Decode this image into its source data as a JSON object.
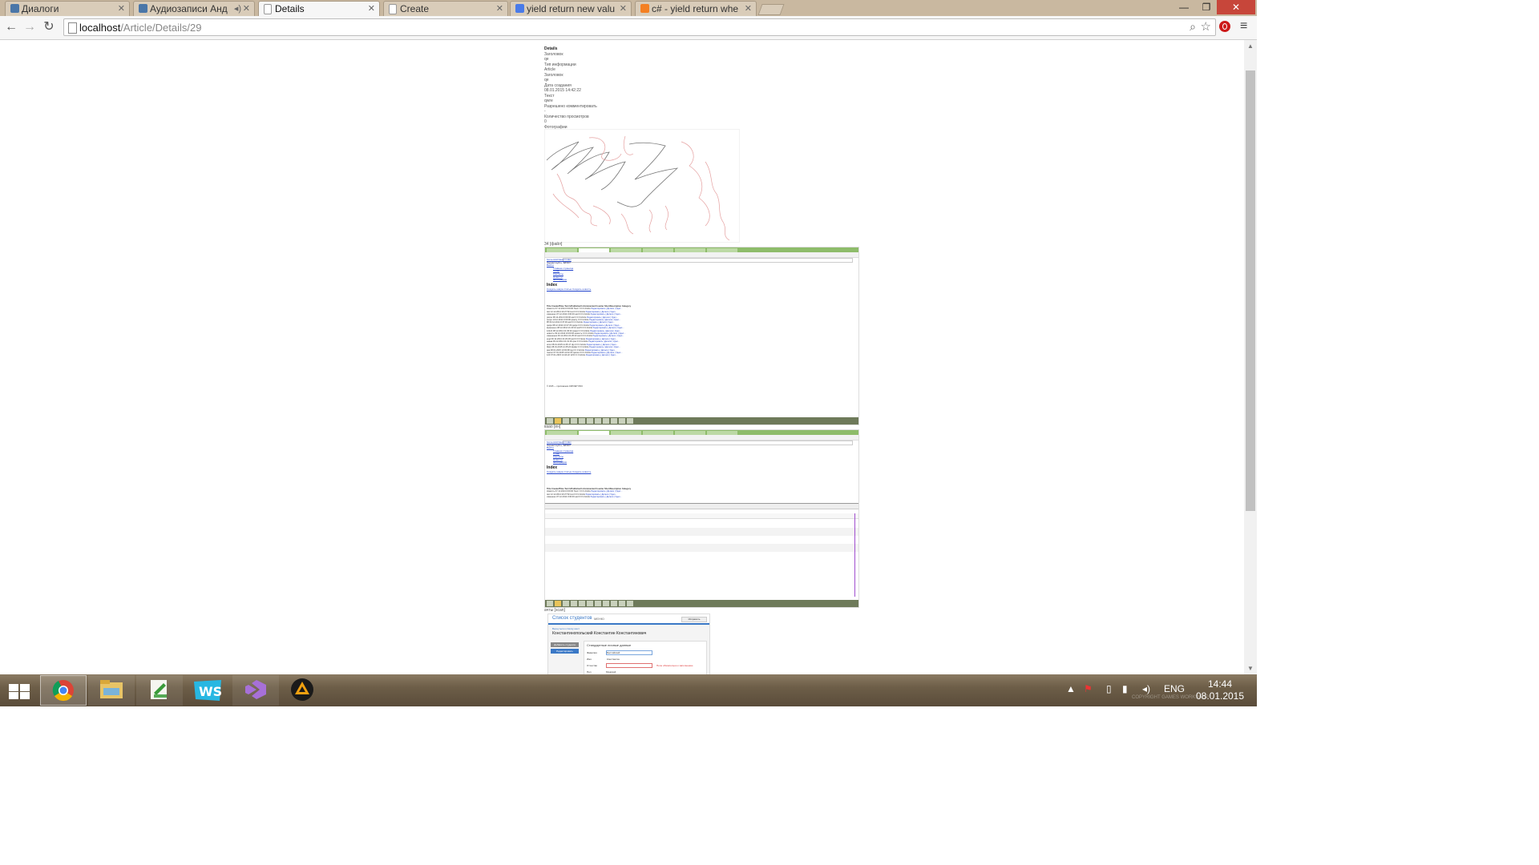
{
  "browser": {
    "tabs": [
      {
        "title": "Диалоги",
        "active": false,
        "icon": "vk-icon",
        "icon_color": "#4a76a8"
      },
      {
        "title": "Аудиозаписи Анд",
        "active": false,
        "icon": "audio-play-icon",
        "icon_color": "#4a76a8"
      },
      {
        "title": "Details",
        "active": true,
        "icon": "page-icon",
        "icon_color": "#ffffff"
      },
      {
        "title": "Create",
        "active": false,
        "icon": "page-icon",
        "icon_color": "#ffffff"
      },
      {
        "title": "yield return new valu",
        "active": false,
        "icon": "google-icon",
        "icon_color": "#4a7be8"
      },
      {
        "title": "c# - yield return whe",
        "active": false,
        "icon": "stackoverflow-icon",
        "icon_color": "#f48024"
      }
    ],
    "url_host": "localhost",
    "url_path": "/Article/Details/29"
  },
  "details": {
    "heading": "Details",
    "fields": [
      "Заголовок",
      "qe",
      "Тип информации",
      "Article",
      "Заголовок",
      "qe",
      "Дата создания",
      "08.01.2015 14:42:22",
      "Текст",
      "qwre",
      "Разрешено комментировать",
      "-",
      "Количество просмотров",
      "0",
      "Фотографии"
    ],
    "photo_captions": [
      "34 [файл]",
      "каао [ен]",
      "ачты [scan]"
    ]
  },
  "embedded_page": {
    "header_links": "home Add News/ index",
    "greeting": "Здравствуйте, admin!",
    "logout": "Выйти",
    "menu": [
      "Главная страница",
      "О нас",
      "Контакты",
      "Новости",
      "Фотографии"
    ],
    "title": "Index",
    "create_links": "Создать новую статью   Создать новость",
    "columns": [
      "Title",
      "CreatedTime",
      "Text",
      "IsPublished",
      "IsCommented",
      "Counter",
      "ShortDescription",
      "Category"
    ],
    "rows": [
      [
        "Новость",
        "07.12.2014 0:00:00",
        "Текст",
        "Article"
      ],
      [
        "test",
        "12.12.2014 23:27:52",
        "test",
        "Article"
      ],
      [
        "изменено",
        "07.12.2014 0:00:00",
        "asd",
        "Article"
      ],
      [
        "рвзгш",
        "08.12.2014 0:00:00",
        "asd",
        "Article"
      ],
      [
        "скоро",
        "10.12.2014 0:00:00",
        "qwerty",
        "Article"
      ],
      [
        "ffff",
        "03.12.2014 0:37:30",
        "asd",
        "Article"
      ],
      [
        "qwqw",
        "08.12.2014 16:27:29",
        "qwqw",
        "Article"
      ],
      [
        "вывешено",
        "08.12.2014 21:23:10",
        "asdf",
        "Article"
      ],
      [
        "12121",
        "08.12.2014 21:36:40",
        "qwqw",
        "Article"
      ],
      [
        "новость",
        "09.12.2014 23:00:00",
        "новость",
        "Article"
      ],
      [
        "изменение",
        "09.12.2014 21:25:23",
        "asd",
        "Article"
      ],
      [
        "ещё",
        "09.12.2014 21:29:18",
        "asd",
        "News"
      ],
      [
        "ааааа",
        "09.12.2014 21:31:00",
        "qwe",
        "Article"
      ],
      [
        "ипоп",
        "08.01.2015 12:45:17",
        "фр",
        "Article"
      ],
      [
        "fdafy",
        "08.01.2015 12:45:20",
        "фрфр",
        "Article"
      ],
      [
        "ака",
        "08.01.2015 13:03:38",
        "ipg",
        "Article"
      ],
      [
        "rwerwr",
        "07.01.2015 14:42:22",
        "qwrwe",
        "Article"
      ],
      [
        "123",
        "07.01.2015 14:44:22",
        "123",
        "Article"
      ]
    ],
    "row_action_labels": "Редактировать | Детали | Удал...",
    "footer": "© 2015 — приложение ASP.NET MVC"
  },
  "students": {
    "title": "Список студентов",
    "menu": "МЕНЮ",
    "button": "Исправить",
    "back": "Вернуться к списку мест",
    "name": "Константинопольский Константин Константинович",
    "card_title": "Стандартные личные данные",
    "fields": [
      {
        "label": "Фамилия",
        "value": "Балтийский"
      },
      {
        "label": "Имя",
        "value": "Константин"
      },
      {
        "label": "Отчество",
        "value": ""
      },
      {
        "label": "Пол",
        "value": "Мужской"
      }
    ],
    "left_buttons": [
      "Добавить студента",
      "Редактировать"
    ],
    "error_hint": "Поле обязательно к заполнению"
  },
  "taskbar": {
    "apps": [
      "chrome-icon",
      "file-explorer-icon",
      "notepad-icon",
      "webstorm-icon",
      "visual-studio-icon",
      "aimp-icon"
    ],
    "lang": "ENG",
    "time": "14:44",
    "date": "08.01.2015",
    "watermark": "COPYRIGHT GAMES WORKSHOP"
  }
}
